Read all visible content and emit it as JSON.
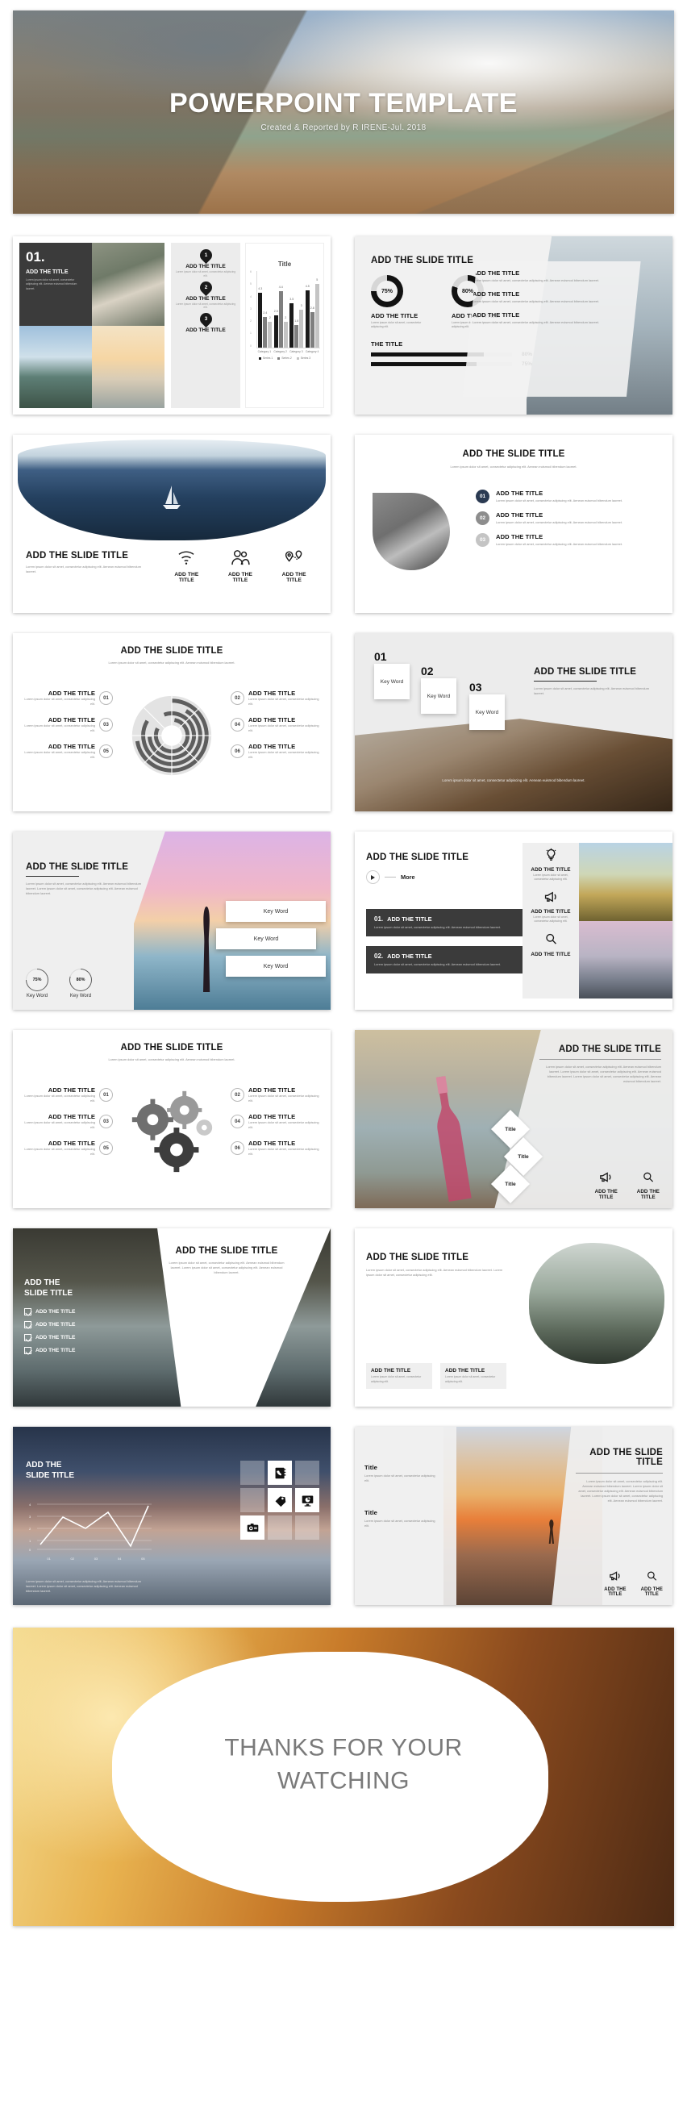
{
  "deck": {
    "title_slide": {
      "title": "POWERPOINT TEMPLATE",
      "subtitle": "Created & Reported  by  R IRENE-Jul. 2018"
    },
    "common": {
      "slide_title": "ADD THE SLIDE TITLE",
      "item_title": "ADD THE TITLE",
      "title_short": "Title",
      "key_word": "Key Word",
      "add_the": "ADD THE",
      "title_word": "TITLE",
      "lorem_short": "Lorem ipsum dolor sit amet, consectetur adipiscing elit.",
      "lorem_medium": "Lorem ipsum dolor sit amet, consectetur adipiscing elit. Aenean euismod bibendum laoreet.",
      "lorem_long": "Lorem ipsum dolor sit amet, consectetur adipiscing elit. Aenean euismod bibendum laoreet. Lorem ipsum dolor sit amet, consectetur adipiscing elit. Aenean euismod bibendum laoreet.",
      "lorem_xlong": "Lorem ipsum dolor sit amet, consectetur adipiscing elit. Aenean euismod bibendum laoreet. Lorem ipsum dolor sit amet, consectetur adipiscing elit. Aenean euismod bibendum laoreet. Lorem ipsum dolor sit amet, consectetur adipiscing elit. Aenean euismod bibendum laoreet."
    },
    "slide02": {
      "number": "01.",
      "title": "ADD THE TITLE",
      "body": "Lorem ipsum dolor sit amet, consectetur adipiscing elit. Aenean euismod bibendum laoreet.",
      "pins": [
        {
          "num": "1",
          "title": "ADD THE TITLE",
          "body": "Lorem ipsum dolor sit amet, consectetur adipiscing elit."
        },
        {
          "num": "2",
          "title": "ADD THE TITLE",
          "body": "Lorem ipsum dolor sit amet, consectetur adipiscing elit."
        },
        {
          "num": "3",
          "title": "ADD THE TITLE",
          "body": "Lorem ipsum dolor sit amet, consectetur adipiscing elit."
        }
      ]
    },
    "slide03": {
      "title": "ADD THE SLIDE TITLE",
      "donuts": [
        {
          "value": "75%",
          "pct": 75,
          "title": "ADD THE TITLE",
          "body": "Lorem ipsum dolor sit amet, consectetur adipiscing elit."
        },
        {
          "value": "80%",
          "pct": 80,
          "title": "ADD THE TITLE",
          "body": "Lorem ipsum dolor sit amet, consectetur adipiscing elit."
        }
      ],
      "bar_heading": "THE TITLE",
      "bars": [
        {
          "label": "80%",
          "pct": 80
        },
        {
          "label": "75%",
          "pct": 75
        }
      ],
      "panel_items": [
        {
          "title": "ADD THE TITLE",
          "body": "Lorem ipsum dolor sit amet, consectetur adipiscing elit. Aenean euismod bibendum laoreet."
        },
        {
          "title": "ADD THE TITLE",
          "body": "Lorem ipsum dolor sit amet, consectetur adipiscing elit. Aenean euismod bibendum laoreet."
        },
        {
          "title": "ADD THE TITLE",
          "body": "Lorem ipsum dolor sit amet, consectetur adipiscing elit. Aenean euismod bibendum laoreet."
        }
      ]
    },
    "slide04": {
      "title": "ADD THE SLIDE TITLE",
      "body": "Lorem ipsum dolor sit amet, consectetur adipiscing elit. Aenean euismod bibendum laoreet.",
      "features": [
        {
          "icon": "wifi-icon",
          "line1": "ADD THE",
          "line2": "TITLE"
        },
        {
          "icon": "people-icon",
          "line1": "ADD THE",
          "line2": "TITLE"
        },
        {
          "icon": "location-pin-icon",
          "line1": "ADD THE",
          "line2": "TITLE"
        }
      ]
    },
    "slide05": {
      "title": "ADD THE SLIDE TITLE",
      "subtitle": "Lorem ipsum dolor sit amet, consectetur adipiscing elit. Aenean euismod bibendum laoreet.",
      "items": [
        {
          "num": "01",
          "title": "ADD THE TITLE",
          "body": "Lorem ipsum dolor sit amet, consectetur adipiscing elit. Aenean euismod bibendum laoreet.",
          "color": "#2b3a52"
        },
        {
          "num": "02",
          "title": "ADD THE TITLE",
          "body": "Lorem ipsum dolor sit amet, consectetur adipiscing elit. Aenean euismod bibendum laoreet.",
          "color": "#8d8d8d"
        },
        {
          "num": "03",
          "title": "ADD THE TITLE",
          "body": "Lorem ipsum dolor sit amet, consectetur adipiscing elit. Aenean euismod bibendum laoreet.",
          "color": "#c4c4c4"
        }
      ]
    },
    "slide06": {
      "title": "ADD THE SLIDE TITLE",
      "subtitle": "Lorem ipsum dolor sit amet, consectetur adipiscing elit. Aenean euismod bibendum laoreet.",
      "items": [
        {
          "num": "01",
          "title": "ADD THE TITLE",
          "body": "Lorem ipsum dolor sit amet, consectetur adipiscing elit."
        },
        {
          "num": "02",
          "title": "ADD THE TITLE",
          "body": "Lorem ipsum dolor sit amet, consectetur adipiscing elit."
        },
        {
          "num": "03",
          "title": "ADD THE TITLE",
          "body": "Lorem ipsum dolor sit amet, consectetur adipiscing elit."
        },
        {
          "num": "04",
          "title": "ADD THE TITLE",
          "body": "Lorem ipsum dolor sit amet, consectetur adipiscing elit."
        },
        {
          "num": "05",
          "title": "ADD THE TITLE",
          "body": "Lorem ipsum dolor sit amet, consectetur adipiscing elit."
        },
        {
          "num": "06",
          "title": "ADD THE TITLE",
          "body": "Lorem ipsum dolor sit amet, consectetur adipiscing elit."
        }
      ]
    },
    "slide07": {
      "title": "ADD THE SLIDE TITLE",
      "body": "Lorem ipsum dolor sit amet, consectetur adipiscing elit. Aenean euismod bibendum laoreet.",
      "caption": "Lorem ipsum dolor sit amet, consectetur adipiscing elit. Aenean euismod bibendum laoreet.",
      "cards": [
        {
          "num": "01",
          "label": "Key Word"
        },
        {
          "num": "02",
          "label": "Key Word"
        },
        {
          "num": "03",
          "label": "Key Word"
        }
      ]
    },
    "slide08": {
      "title": "ADD THE SLIDE TITLE",
      "body": "Lorem ipsum dolor sit amet, consectetur adipiscing elit. Aenean euismod bibendum laoreet. Lorem ipsum dolor sit amet, consectetur adipiscing elit. Aenean euismod bibendum laoreet.",
      "keywords": [
        "Key Word",
        "Key Word",
        "Key Word"
      ],
      "gauges": [
        {
          "value": "75%",
          "pct": 75,
          "label": "Key Word"
        },
        {
          "value": "80%",
          "pct": 80,
          "label": "Key Word"
        }
      ]
    },
    "slide09": {
      "title": "ADD THE SLIDE TITLE",
      "more_label": "More",
      "rows": [
        {
          "num": "01.",
          "title": "ADD THE TITLE",
          "body": "Lorem ipsum dolor sit amet, consectetur adipiscing elit. Aenean euismod bibendum laoreet."
        },
        {
          "num": "02.",
          "title": "ADD THE TITLE",
          "body": "Lorem ipsum dolor sit amet, consectetur adipiscing elit. Aenean euismod bibendum laoreet."
        }
      ],
      "icon_items": [
        {
          "icon": "lightbulb-icon",
          "title": "ADD THE TITLE",
          "body": "Lorem ipsum dolor sit amet, consectetur adipiscing elit."
        },
        {
          "icon": "megaphone-icon",
          "title": "ADD THE TITLE",
          "body": "Lorem ipsum dolor sit amet, consectetur adipiscing elit."
        },
        {
          "icon": "magnifier-icon",
          "title": "ADD THE TITLE",
          "body": "Lorem ipsum dolor sit amet, consectetur adipiscing elit."
        }
      ]
    },
    "slide10": {
      "title": "ADD THE SLIDE TITLE",
      "subtitle": "Lorem ipsum dolor sit amet, consectetur adipiscing elit. Aenean euismod bibendum laoreet.",
      "items": [
        {
          "num": "01",
          "title": "ADD THE TITLE",
          "body": "Lorem ipsum dolor sit amet, consectetur adipiscing elit."
        },
        {
          "num": "02",
          "title": "ADD THE TITLE",
          "body": "Lorem ipsum dolor sit amet, consectetur adipiscing elit."
        },
        {
          "num": "03",
          "title": "ADD THE TITLE",
          "body": "Lorem ipsum dolor sit amet, consectetur adipiscing elit."
        },
        {
          "num": "04",
          "title": "ADD THE TITLE",
          "body": "Lorem ipsum dolor sit amet, consectetur adipiscing elit."
        },
        {
          "num": "05",
          "title": "ADD THE TITLE",
          "body": "Lorem ipsum dolor sit amet, consectetur adipiscing elit."
        },
        {
          "num": "06",
          "title": "ADD THE TITLE",
          "body": "Lorem ipsum dolor sit amet, consectetur adipiscing elit."
        }
      ]
    },
    "slide11": {
      "title": "ADD THE SLIDE TITLE",
      "body": "Lorem ipsum dolor sit amet, consectetur adipiscing elit. Aenean euismod bibendum laoreet. Lorem ipsum dolor sit amet, consectetur adipiscing elit. Aenean euismod bibendum laoreet. Lorem ipsum dolor sit amet, consectetur adipiscing elit. Aenean euismod bibendum laoreet.",
      "diamonds": [
        "Title",
        "Title",
        "Title"
      ],
      "icons": [
        {
          "icon": "megaphone-icon",
          "line1": "ADD THE",
          "line2": "TITLE"
        },
        {
          "icon": "magnifier-icon",
          "line1": "ADD THE",
          "line2": "TITLE"
        }
      ]
    },
    "slide12": {
      "title_line1": "ADD THE",
      "title_line2": "SLIDE TITLE",
      "checks": [
        "ADD THE TITLE",
        "ADD THE TITLE",
        "ADD THE TITLE",
        "ADD THE TITLE"
      ],
      "right_title": "ADD THE SLIDE TITLE",
      "right_body": "Lorem ipsum dolor sit amet, consectetur adipiscing elit. Aenean euismod bibendum laoreet. Lorem ipsum dolor sit amet, consectetur adipiscing elit. Aenean euismod bibendum laoreet."
    },
    "slide13": {
      "title": "ADD THE SLIDE TITLE",
      "body": "Lorem ipsum dolor sit amet, consectetur adipiscing elit. Aenean euismod bibendum laoreet. Lorem ipsum dolor sit amet, consectetur adipiscing elit.",
      "cards": [
        {
          "title": "ADD THE TITLE",
          "body": "Lorem ipsum dolor sit amet, consectetur adipiscing elit."
        },
        {
          "title": "ADD THE TITLE",
          "body": "Lorem ipsum dolor sit amet, consectetur adipiscing elit."
        }
      ]
    },
    "slide14": {
      "title_line1": "ADD THE",
      "title_line2": "SLIDE TITLE",
      "body": "Lorem ipsum dolor sit amet, consectetur adipiscing elit. Aenean euismod bibendum laoreet. Lorem ipsum dolor sit amet, consectetur adipiscing elit. Aenean euismod bibendum laoreet.",
      "tiles": [
        {
          "icon": "none",
          "style": "ghost"
        },
        {
          "icon": "phone-book-icon",
          "style": "white"
        },
        {
          "icon": "none",
          "style": "ghost"
        },
        {
          "icon": "none",
          "style": "ghost"
        },
        {
          "icon": "price-tag-icon",
          "style": "white"
        },
        {
          "icon": "monitor-chart-icon",
          "style": "white"
        },
        {
          "icon": "camera-icon",
          "style": "white"
        },
        {
          "icon": "none",
          "style": "ghost"
        },
        {
          "icon": "none",
          "style": "ghost"
        }
      ]
    },
    "slide15": {
      "title_line1": "ADD THE SLIDE",
      "title_line2": "TITLE",
      "body": "Lorem ipsum dolor sit amet, consectetur adipiscing elit. Aenean euismod bibendum laoreet. Lorem ipsum dolor sit amet, consectetur adipiscing elit. Aenean euismod bibendum laoreet. Lorem ipsum dolor sit amet, consectetur adipiscing elit. Aenean euismod bibendum laoreet.",
      "left_items": [
        {
          "title": "Title",
          "body": "Lorem ipsum dolor sit amet, consectetur adipiscing elit."
        },
        {
          "title": "Title",
          "body": "Lorem ipsum dolor sit amet, consectetur adipiscing elit."
        }
      ],
      "icons": [
        {
          "icon": "megaphone-icon",
          "line1": "ADD THE",
          "line2": "TITLE"
        },
        {
          "icon": "magnifier-icon",
          "line1": "ADD THE",
          "line2": "TITLE"
        }
      ]
    },
    "final_slide": {
      "line1": "THANKS FOR YOUR",
      "line2": "WATCHING"
    }
  },
  "chart_data": [
    {
      "type": "bar",
      "title": "Title",
      "categories": [
        "Category 1",
        "Category 2",
        "Category 3",
        "Category 4"
      ],
      "series": [
        {
          "name": "Series 1",
          "values": [
            4.3,
            2.5,
            3.5,
            4.5
          ],
          "color": "#1a1a1a"
        },
        {
          "name": "Series 2",
          "values": [
            2.4,
            4.4,
            1.8,
            2.8
          ],
          "color": "#7f7f7f"
        },
        {
          "name": "Series 3",
          "values": [
            2,
            2,
            3,
            5
          ],
          "color": "#c4c4c4"
        }
      ],
      "xlabel": "",
      "ylabel": "",
      "ylim": [
        0,
        6
      ],
      "yticks": [
        6,
        5,
        4,
        3,
        2,
        1,
        0
      ],
      "grid": true,
      "legend_position": "bottom"
    },
    {
      "type": "line",
      "title": "",
      "x": [
        "01",
        "02",
        "03",
        "04",
        "05"
      ],
      "values": [
        0.3,
        3.4,
        2.6,
        4.4,
        0.8
      ],
      "ylim": [
        0,
        5
      ],
      "yticks": [
        0,
        1,
        2,
        3,
        4
      ],
      "grid": true,
      "legend_position": "none"
    },
    {
      "type": "pie",
      "title": "",
      "labels": [
        "01",
        "02",
        "03",
        "04",
        "05",
        "06"
      ],
      "values": [
        16,
        17,
        16,
        17,
        17,
        17
      ],
      "colors": [
        "#5a5a5a",
        "#6a6a6a",
        "#7a7a7a",
        "#8a8a8a",
        "#9a9a9a",
        "#d8d8d8"
      ]
    }
  ]
}
